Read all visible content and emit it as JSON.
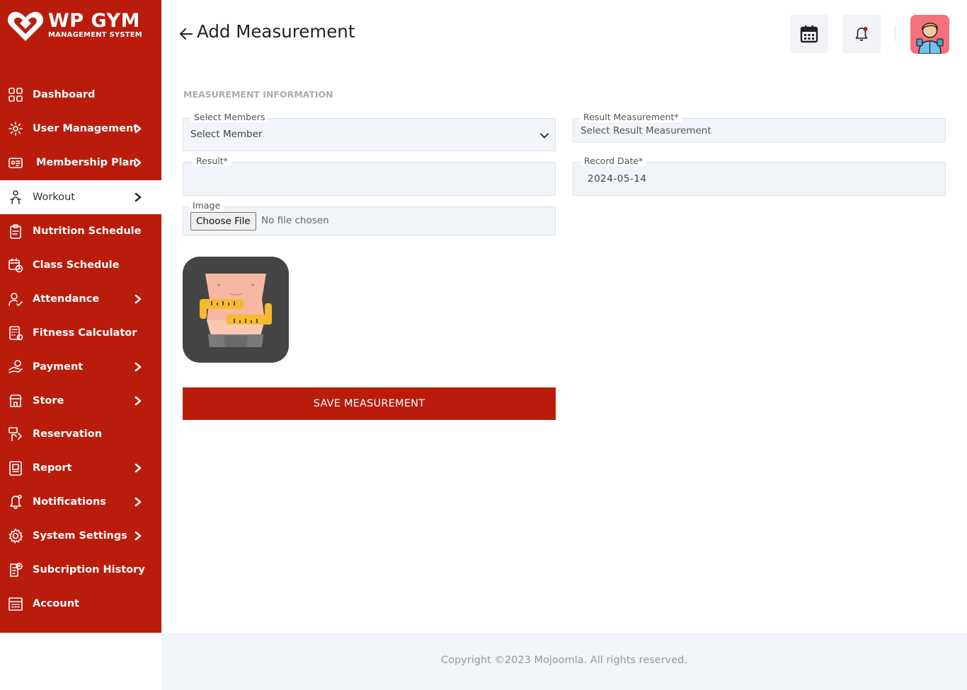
{
  "brand": {
    "title": "WP GYM",
    "subtitle": "MANAGEMENT SYSTEM",
    "accent": "#ba1c0c"
  },
  "sidebar": {
    "items": [
      {
        "label": "Dashboard",
        "icon": "grid-icon",
        "has_submenu": false,
        "active": false
      },
      {
        "label": "User Management",
        "icon": "users-gear-icon",
        "has_submenu": true,
        "active": false
      },
      {
        "label": "Membership Plan",
        "icon": "id-card-icon",
        "has_submenu": true,
        "active": false
      },
      {
        "label": "Workout",
        "icon": "workout-icon",
        "has_submenu": true,
        "active": true
      },
      {
        "label": "Nutrition Schedule",
        "icon": "clipboard-icon",
        "has_submenu": false,
        "active": false
      },
      {
        "label": "Class Schedule",
        "icon": "calendar-clock-icon",
        "has_submenu": false,
        "active": false
      },
      {
        "label": "Attendance",
        "icon": "user-check-icon",
        "has_submenu": true,
        "active": false
      },
      {
        "label": "Fitness Calculator",
        "icon": "calculator-icon",
        "has_submenu": false,
        "active": false
      },
      {
        "label": "Payment",
        "icon": "hand-money-icon",
        "has_submenu": true,
        "active": false
      },
      {
        "label": "Store",
        "icon": "store-icon",
        "has_submenu": true,
        "active": false
      },
      {
        "label": "Reservation",
        "icon": "reservation-icon",
        "has_submenu": false,
        "active": false
      },
      {
        "label": "Report",
        "icon": "report-icon",
        "has_submenu": true,
        "active": false
      },
      {
        "label": "Notifications",
        "icon": "bell-icon",
        "has_submenu": true,
        "active": false
      },
      {
        "label": "System Settings",
        "icon": "gear-icon",
        "has_submenu": true,
        "active": false
      },
      {
        "label": "Subcription History",
        "icon": "history-doc-icon",
        "has_submenu": false,
        "active": false
      },
      {
        "label": "Account",
        "icon": "account-icon",
        "has_submenu": false,
        "active": false
      }
    ]
  },
  "header": {
    "title": "Add Measurement",
    "calendar_icon": "calendar-icon",
    "notification_icon": "bell-icon"
  },
  "form": {
    "section_title": "MEASUREMENT INFORMATION",
    "member": {
      "label": "Select Members",
      "value": "Select Member"
    },
    "result_measurement": {
      "label": "Result Measurement*",
      "value": "Select Result Measurement"
    },
    "result": {
      "label": "Result*",
      "value": ""
    },
    "record_date": {
      "label": "Record Date*",
      "value": "2024-05-14"
    },
    "image": {
      "label": "Image",
      "button": "Choose File",
      "status": "No file chosen"
    },
    "save_button": "SAVE MEASUREMENT"
  },
  "footer": {
    "copyright": "Copyright ©2023 Mojoomla. All rights reserved."
  }
}
